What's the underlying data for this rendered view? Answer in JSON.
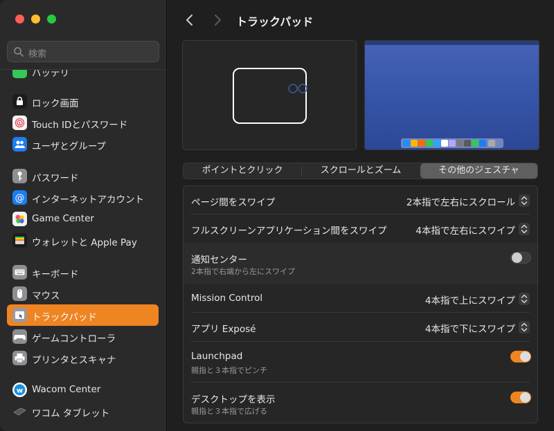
{
  "sidebar": {
    "search_placeholder": "検索",
    "partial_item": "バッテリ",
    "items": [
      {
        "label": "ロック画面",
        "icon": "lock-icon"
      },
      {
        "label": "Touch IDとパスワード",
        "icon": "fingerprint-icon"
      },
      {
        "label": "ユーザとグループ",
        "icon": "users-icon"
      },
      {
        "label": "パスワード",
        "icon": "key-icon"
      },
      {
        "label": "インターネットアカウント",
        "icon": "at-icon"
      },
      {
        "label": "Game Center",
        "icon": "game-center-icon"
      },
      {
        "label": "ウォレットと Apple Pay",
        "icon": "wallet-icon"
      },
      {
        "label": "キーボード",
        "icon": "keyboard-icon"
      },
      {
        "label": "マウス",
        "icon": "mouse-icon"
      },
      {
        "label": "トラックパッド",
        "icon": "trackpad-icon",
        "active": true
      },
      {
        "label": "ゲームコントローラ",
        "icon": "gamepad-icon"
      },
      {
        "label": "プリンタとスキャナ",
        "icon": "printer-icon"
      },
      {
        "label": "Wacom Center",
        "icon": "wacom-icon"
      },
      {
        "label": "ワコム タブレット",
        "icon": "tablet-icon"
      }
    ]
  },
  "header": {
    "title": "トラックパッド"
  },
  "tabs": [
    {
      "label": "ポイントとクリック"
    },
    {
      "label": "スクロールとズーム"
    },
    {
      "label": "その他のジェスチャ",
      "active": true
    }
  ],
  "settings": [
    {
      "label": "ページ間をスワイプ",
      "value": "2本指で左右にスクロール",
      "control": "popup"
    },
    {
      "label": "フルスクリーンアプリケーション間をスワイプ",
      "value": "4本指で左右にスワイプ",
      "control": "popup"
    },
    {
      "label": "通知センター",
      "sub": "2本指で右端から左にスワイプ",
      "control": "toggle",
      "on": false
    },
    {
      "label": "Mission Control",
      "value": "4本指で上にスワイプ",
      "control": "popup"
    },
    {
      "label": "アプリ Exposé",
      "value": "4本指で下にスワイプ",
      "control": "popup"
    },
    {
      "label": "Launchpad",
      "sub": "親指と３本指でピンチ",
      "control": "toggle",
      "on": true
    },
    {
      "label": "デスクトップを表示",
      "sub": "親指と３本指で広げる",
      "control": "toggle",
      "on": true
    }
  ],
  "colors": {
    "accent": "#ee8422",
    "toggle_off": "#3e3e3e"
  }
}
